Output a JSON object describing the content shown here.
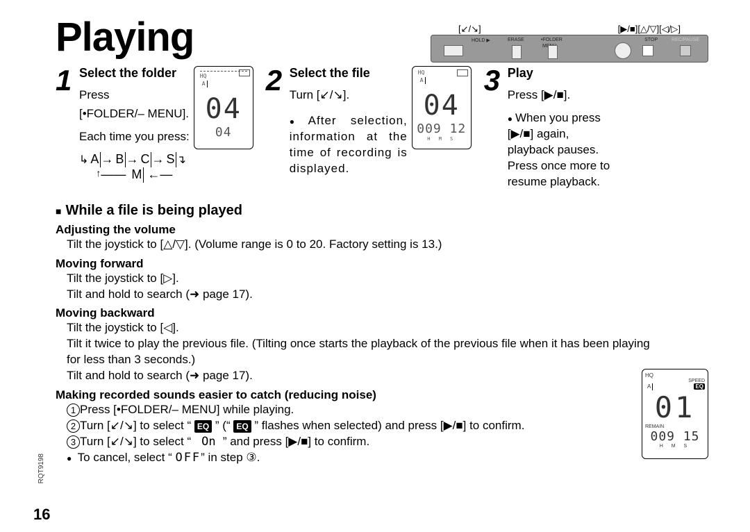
{
  "title": "Playing",
  "page_number": "16",
  "doc_code": "RQT9198",
  "device": {
    "callout_left": "[↙/↘]",
    "callout_right": "[▶/■][△/▽][◁/▷]",
    "label_hold": "HOLD ▶",
    "label_erase": "ERASE",
    "label_folder": "•FOLDER",
    "label_menu": "MENU",
    "label_stop": "STOP",
    "label_recpause": "REC/PAUSE"
  },
  "steps": [
    {
      "num": "1",
      "title": "Select the folder",
      "line1": "Press",
      "line2": "[•FOLDER/– MENU].",
      "line3": "Each time you press:",
      "seq_a": "A",
      "seq_b": "B",
      "seq_c": "C",
      "seq_s": "S",
      "seq_m": "M",
      "lcd": {
        "hq": "HQ",
        "folder": "A",
        "big": "04",
        "small": "04"
      }
    },
    {
      "num": "2",
      "title": "Select the file",
      "line1": "Turn [↙/↘].",
      "bullet": "After selection, information at the time of recording is displayed.",
      "lcd": {
        "hq": "HQ",
        "folder": "A",
        "big": "04",
        "time": "009 12",
        "hms": "H   M   S"
      }
    },
    {
      "num": "3",
      "title": "Play",
      "line1": "Press [▶/■].",
      "bullet": "When you press [▶/■] again, playback pauses. Press once more to resume playback."
    }
  ],
  "while_playing": {
    "heading": "While a file is being played",
    "subs": [
      {
        "title": "Adjusting the volume",
        "text": "Tilt the joystick to [△/▽]. (Volume range is 0 to 20. Factory setting is 13.)"
      },
      {
        "title": "Moving forward",
        "l1": "Tilt the joystick to [▷].",
        "l2": "Tilt and hold to search (➜ page 17)."
      },
      {
        "title": "Moving backward",
        "l1": "Tilt the joystick to [◁].",
        "l2": "Tilt it twice to play the previous file. (Tilting once starts the playback of the previous file when it has been playing for less than 3 seconds.)",
        "l3": "Tilt and hold to search (➜ page 17)."
      },
      {
        "title": "Making recorded sounds easier to catch (reducing noise)",
        "s1a": "Press [•FOLDER/– MENU] while playing.",
        "s2a": "Turn [↙/↘] to select “ ",
        "s2_eq": "EQ",
        "s2b": " ” (“ ",
        "s2_eq2": "EQ",
        "s2c": " ” flashes when selected) and press [▶/■] to confirm.",
        "s3a": "Turn [↙/↘] to select “ ",
        "s3_on": " On ",
        "s3b": "” and press [▶/■] to confirm.",
        "cancel_a": "To cancel, select “ ",
        "cancel_off": "OFF",
        "cancel_b": "” in step ③."
      }
    ]
  },
  "lcd_right": {
    "hq": "HQ",
    "speed": "SPEED",
    "folder": "A",
    "eq": "EQ",
    "big": "01",
    "remain": "REMAIN",
    "time": "009 15",
    "hms": "H   M   S"
  }
}
